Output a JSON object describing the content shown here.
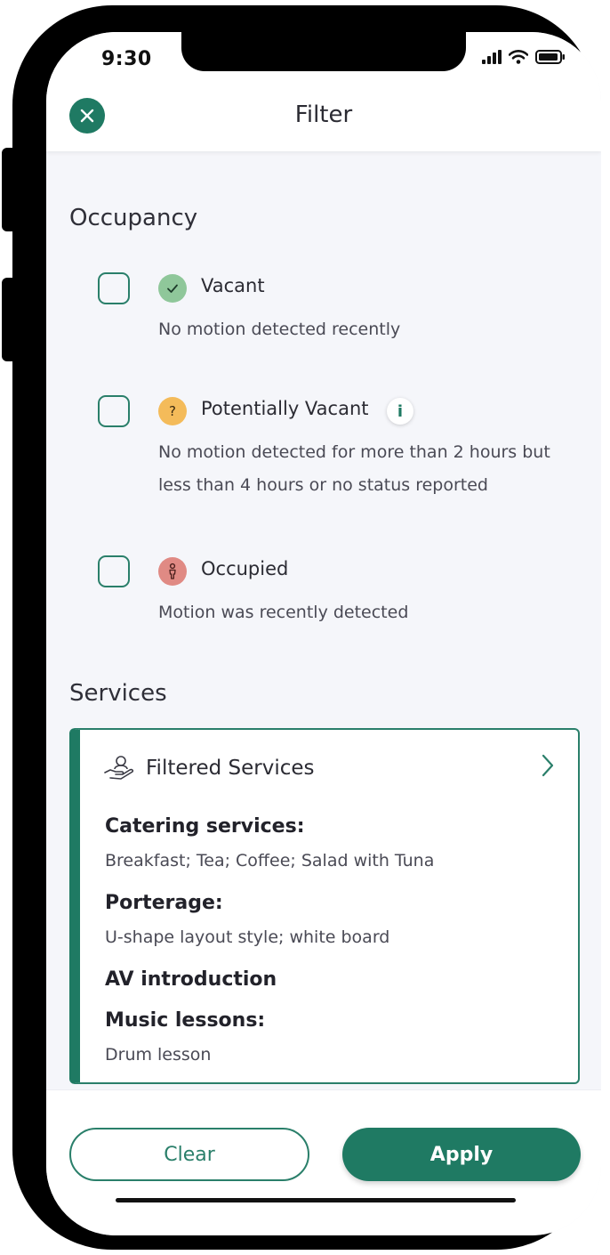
{
  "status_bar": {
    "time": "9:30"
  },
  "header": {
    "title": "Filter"
  },
  "occupancy": {
    "title": "Occupancy",
    "options": [
      {
        "label": "Vacant",
        "description": "No motion detected recently",
        "color": "#8fc79a"
      },
      {
        "label": "Potentially Vacant",
        "description": "No motion detected for more than 2 hours but less than 4 hours or no status reported",
        "color": "#f4bb5a",
        "info": "i"
      },
      {
        "label": "Occupied",
        "description": "Motion was recently detected",
        "color": "#e08a84"
      }
    ]
  },
  "services": {
    "title": "Services",
    "card_title": "Filtered Services",
    "groups": [
      {
        "name": "Catering services:",
        "items": "Breakfast; Tea; Coffee; Salad with Tuna"
      },
      {
        "name": "Porterage:",
        "items": "U-shape layout style; white board"
      },
      {
        "name": "AV introduction"
      },
      {
        "name": "Music lessons:",
        "items": "Drum lesson"
      }
    ]
  },
  "footer": {
    "clear_label": "Clear",
    "apply_label": "Apply"
  },
  "colors": {
    "accent": "#1f7a63",
    "background": "#f5f6fa"
  }
}
